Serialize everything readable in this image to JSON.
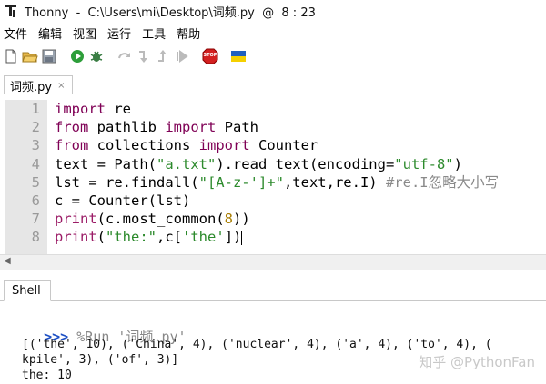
{
  "window": {
    "title": "Thonny  -  C:\\Users\\mi\\Desktop\\词频.py  @  8 : 23"
  },
  "menu": [
    "文件",
    "编辑",
    "视图",
    "运行",
    "工具",
    "帮助"
  ],
  "toolbar": {
    "icons": [
      "new-file-icon",
      "open-folder-icon",
      "save-icon",
      "run-icon",
      "debug-icon",
      "step-over-icon",
      "step-into-icon",
      "step-out-icon",
      "resume-icon",
      "stop-icon",
      "ukraine-flag-icon"
    ],
    "stop_label": "STOP"
  },
  "editor": {
    "tab_label": "词频.py",
    "tab_close": "×",
    "line_numbers": [
      "1",
      "2",
      "3",
      "4",
      "5",
      "6",
      "7",
      "8"
    ],
    "lines": [
      [
        {
          "t": "import",
          "c": "kw"
        },
        {
          "t": " re",
          "c": ""
        }
      ],
      [
        {
          "t": "from",
          "c": "kw"
        },
        {
          "t": " pathlib ",
          "c": ""
        },
        {
          "t": "import",
          "c": "kw"
        },
        {
          "t": " Path",
          "c": ""
        }
      ],
      [
        {
          "t": "from",
          "c": "kw"
        },
        {
          "t": " collections ",
          "c": ""
        },
        {
          "t": "import",
          "c": "kw"
        },
        {
          "t": " Counter",
          "c": ""
        }
      ],
      [
        {
          "t": "text = Path(",
          "c": ""
        },
        {
          "t": "\"a.txt\"",
          "c": "str"
        },
        {
          "t": ").read_text(encoding=",
          "c": ""
        },
        {
          "t": "\"utf-8\"",
          "c": "str"
        },
        {
          "t": ")",
          "c": ""
        }
      ],
      [
        {
          "t": "lst = re.findall(",
          "c": ""
        },
        {
          "t": "\"[A-z-']+\"",
          "c": "str"
        },
        {
          "t": ",text,re.I) ",
          "c": ""
        },
        {
          "t": "#re.I忽略大小写",
          "c": "cmt"
        }
      ],
      [
        {
          "t": "c = Counter(lst)",
          "c": ""
        }
      ],
      [
        {
          "t": "print",
          "c": "kw2"
        },
        {
          "t": "(c.most_common(",
          "c": ""
        },
        {
          "t": "8",
          "c": "num"
        },
        {
          "t": "))",
          "c": ""
        }
      ],
      [
        {
          "t": "print",
          "c": "kw2"
        },
        {
          "t": "(",
          "c": ""
        },
        {
          "t": "\"the:\"",
          "c": "str"
        },
        {
          "t": ",c[",
          "c": ""
        },
        {
          "t": "'the'",
          "c": "str"
        },
        {
          "t": "])",
          "c": ""
        }
      ]
    ]
  },
  "shell": {
    "tab_label": "Shell",
    "prompt": ">>>",
    "command": " %Run '词频.py'",
    "output": [
      "[('the', 10), ('China', 4), ('nuclear', 4), ('a', 4), ('to', 4), (",
      "kpile', 3), ('of', 3)]",
      "the: 10"
    ]
  },
  "watermark": "知乎 @PythonFan"
}
